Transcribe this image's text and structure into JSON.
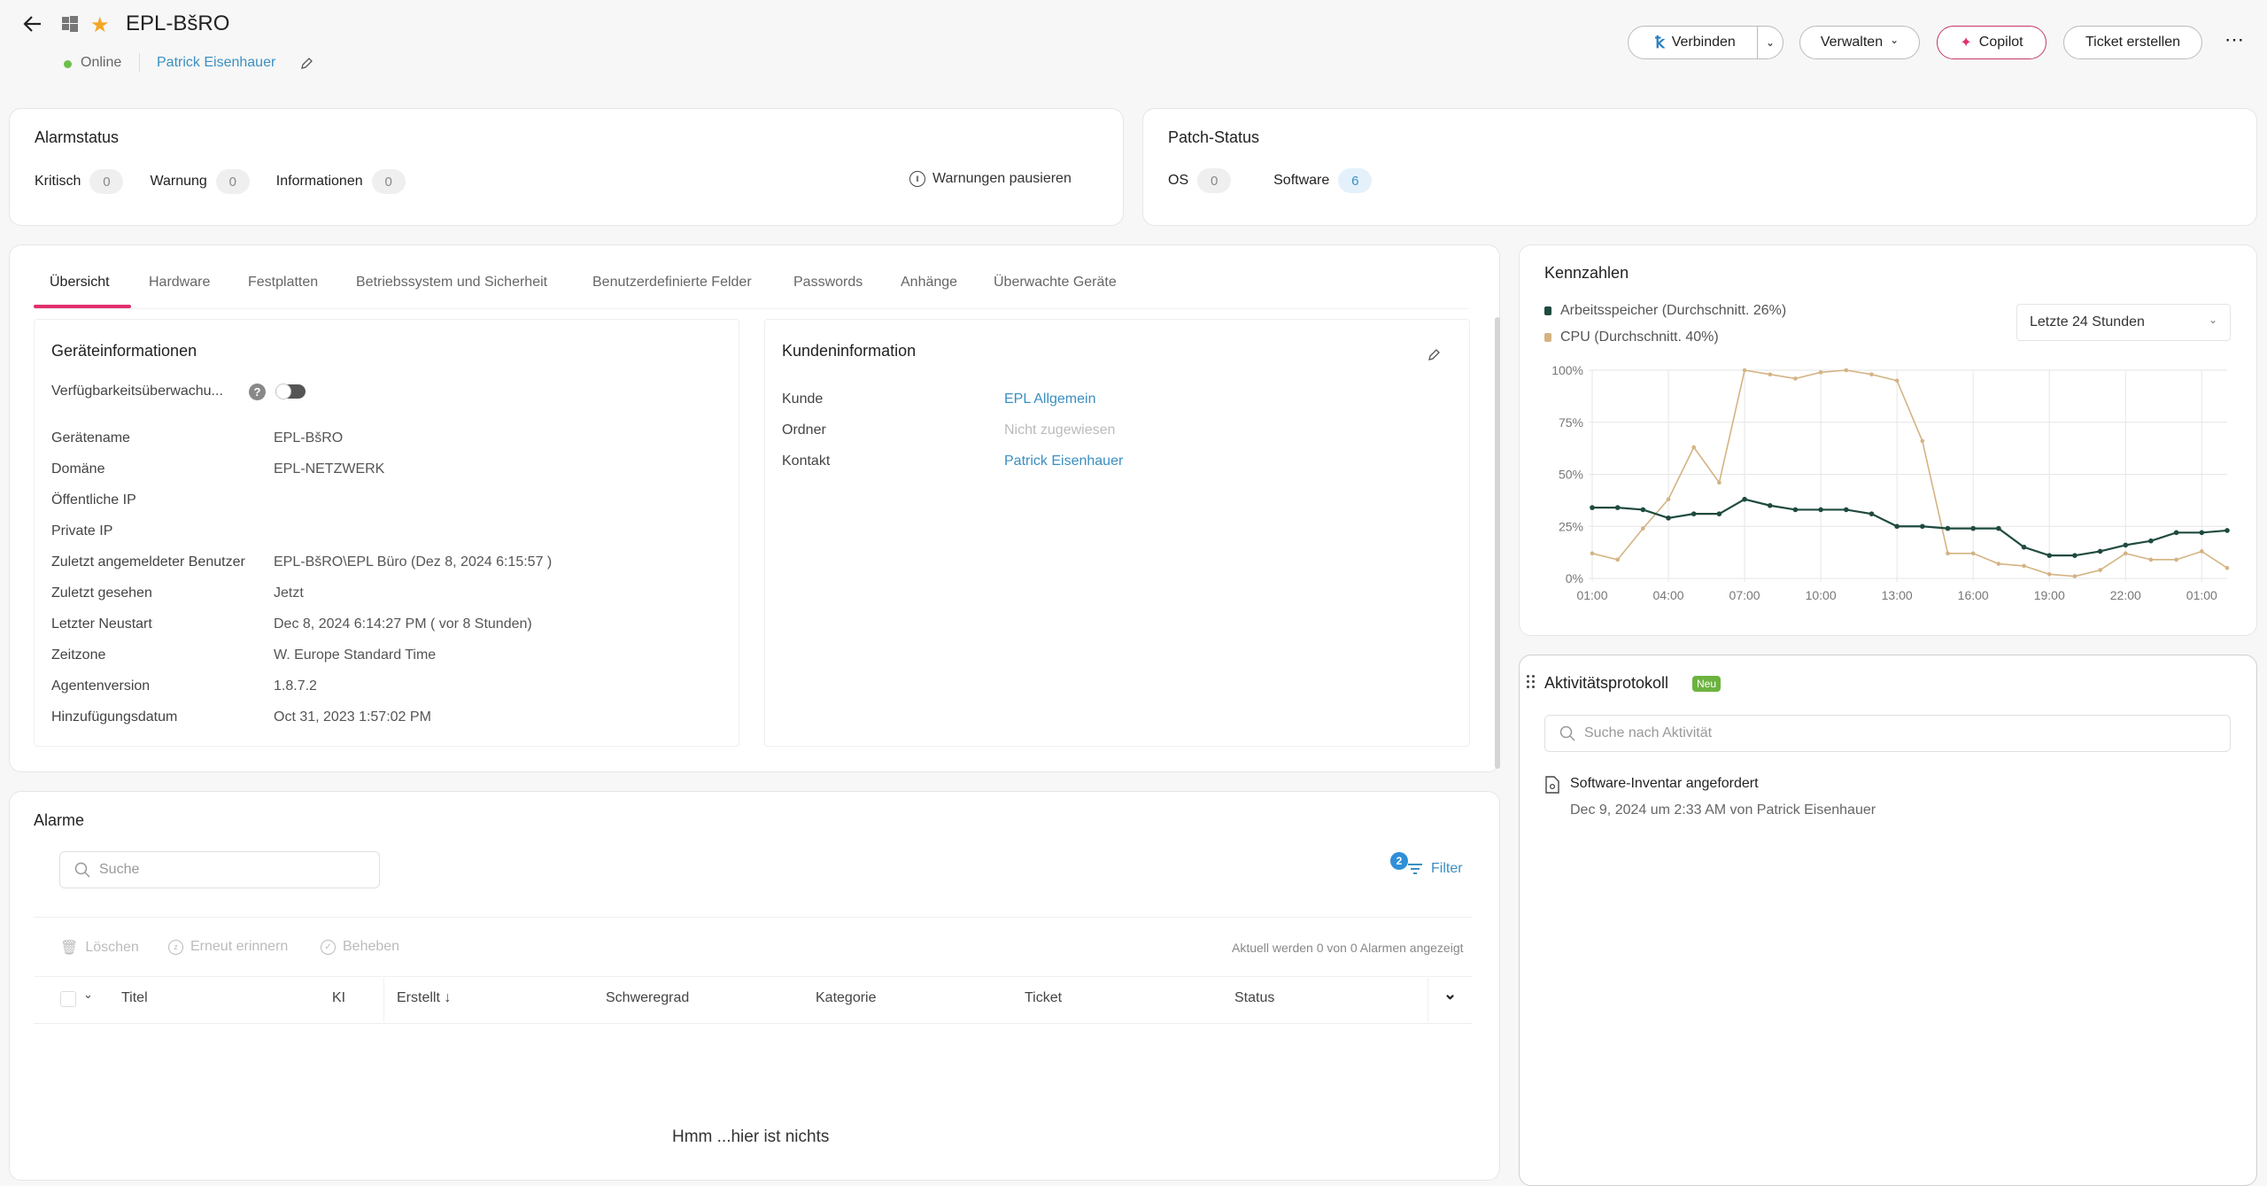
{
  "header": {
    "device_name": "EPL-BšRO",
    "status": "Online",
    "status_color": "#6cbf4a",
    "owner": "Patrick Eisenhauer",
    "favorite_color": "#f5a623",
    "buttons": {
      "connect": "Verbinden",
      "manage": "Verwalten",
      "copilot": "Copilot",
      "create_ticket": "Ticket erstellen"
    }
  },
  "alarm_status": {
    "title": "Alarmstatus",
    "items": [
      {
        "label": "Kritisch",
        "count": "0"
      },
      {
        "label": "Warnung",
        "count": "0"
      },
      {
        "label": "Informationen",
        "count": "0"
      }
    ],
    "pause_label": "Warnungen pausieren"
  },
  "patch_status": {
    "title": "Patch-Status",
    "items": [
      {
        "label": "OS",
        "count": "0"
      },
      {
        "label": "Software",
        "count": "6"
      }
    ]
  },
  "tabs": [
    {
      "label": "Übersicht",
      "active": true
    },
    {
      "label": "Hardware"
    },
    {
      "label": "Festplatten"
    },
    {
      "label": "Betriebssystem und Sicherheit"
    },
    {
      "label": "Benutzerdefinierte Felder"
    },
    {
      "label": "Passwords"
    },
    {
      "label": "Anhänge"
    },
    {
      "label": "Überwachte Geräte"
    }
  ],
  "accent_color": "#e0306e",
  "device_info": {
    "title": "Geräteinformationen",
    "availability_label": "Verfügbarkeitsüberwachu...",
    "availability_enabled": false,
    "rows": [
      {
        "label": "Gerätename",
        "value": "EPL-BšRO"
      },
      {
        "label": "Domäne",
        "value": "EPL-NETZWERK"
      },
      {
        "label": "Öffentliche IP",
        "value": ""
      },
      {
        "label": "Private IP",
        "value": ""
      },
      {
        "label": "Zuletzt angemeldeter Benutzer",
        "value": "EPL-BšRO\\EPL Büro (Dez 8, 2024 6:15:57 )"
      },
      {
        "label": "Zuletzt gesehen",
        "value": "Jetzt"
      },
      {
        "label": "Letzter Neustart",
        "value": "Dec 8, 2024 6:14:27 PM ( vor 8 Stunden)"
      },
      {
        "label": "Zeitzone",
        "value": "W. Europe Standard Time"
      },
      {
        "label": "Agentenversion",
        "value": "1.8.7.2"
      },
      {
        "label": "Hinzufügungsdatum",
        "value": "Oct 31, 2023 1:57:02 PM"
      }
    ]
  },
  "customer_info": {
    "title": "Kundeninformation",
    "rows": [
      {
        "label": "Kunde",
        "value": "EPL Allgemein"
      },
      {
        "label": "Ordner",
        "value": "Nicht zugewiesen"
      },
      {
        "label": "Kontakt",
        "value": "Patrick Eisenhauer"
      }
    ]
  },
  "metrics": {
    "title": "Kennzahlen",
    "range_select": "Letzte 24 Stunden"
  },
  "chart_data": {
    "type": "line",
    "title": "Kennzahlen",
    "xlabel": "",
    "ylabel": "",
    "ylim": [
      0,
      100
    ],
    "yticks": [
      "0%",
      "25%",
      "50%",
      "75%",
      "100%"
    ],
    "xticks": [
      "01:00",
      "04:00",
      "07:00",
      "10:00",
      "13:00",
      "16:00",
      "19:00",
      "22:00",
      "01:00"
    ],
    "x": [
      "01:00",
      "02:00",
      "03:00",
      "04:00",
      "05:00",
      "06:00",
      "07:00",
      "08:00",
      "09:00",
      "10:00",
      "11:00",
      "12:00",
      "13:00",
      "14:00",
      "15:00",
      "16:00",
      "17:00",
      "18:00",
      "19:00",
      "20:00",
      "21:00",
      "22:00",
      "23:00",
      "00:00",
      "01:00",
      "02:00"
    ],
    "grid": true,
    "legend": "top-left",
    "series": [
      {
        "name": "Arbeitsspeicher (Durchschnitt. 26%)",
        "color": "#1f4a3f",
        "values": [
          34,
          34,
          33,
          29,
          31,
          31,
          38,
          35,
          33,
          33,
          33,
          31,
          25,
          25,
          24,
          24,
          24,
          15,
          11,
          11,
          13,
          16,
          18,
          22,
          22,
          23
        ]
      },
      {
        "name": "CPU (Durchschnitt. 40%)",
        "color": "#d4b383",
        "values": [
          12,
          9,
          24,
          38,
          63,
          46,
          100,
          98,
          96,
          99,
          100,
          98,
          95,
          66,
          12,
          12,
          7,
          6,
          2,
          1,
          4,
          12,
          9,
          9,
          13,
          5
        ]
      }
    ]
  },
  "activity": {
    "title": "Aktivitätsprotokoll",
    "new_badge": "Neu",
    "search_placeholder": "Suche nach Aktivität",
    "items": [
      {
        "title": "Software-Inventar angefordert",
        "meta": "Dec 9, 2024 um 2:33 AM von Patrick Eisenhauer"
      }
    ]
  },
  "alarms": {
    "title": "Alarme",
    "search_placeholder": "Suche",
    "filter_label": "Filter",
    "filter_count": "2",
    "actions": {
      "delete": "Löschen",
      "snooze": "Erneut erinnern",
      "resolve": "Beheben"
    },
    "count_text": "Aktuell werden 0 von 0 Alarmen angezeigt",
    "columns": [
      "Titel",
      "KI",
      "Erstellt ↓",
      "Schweregrad",
      "Kategorie",
      "Ticket",
      "Status"
    ],
    "empty_text": "Hmm ...hier ist nichts"
  }
}
